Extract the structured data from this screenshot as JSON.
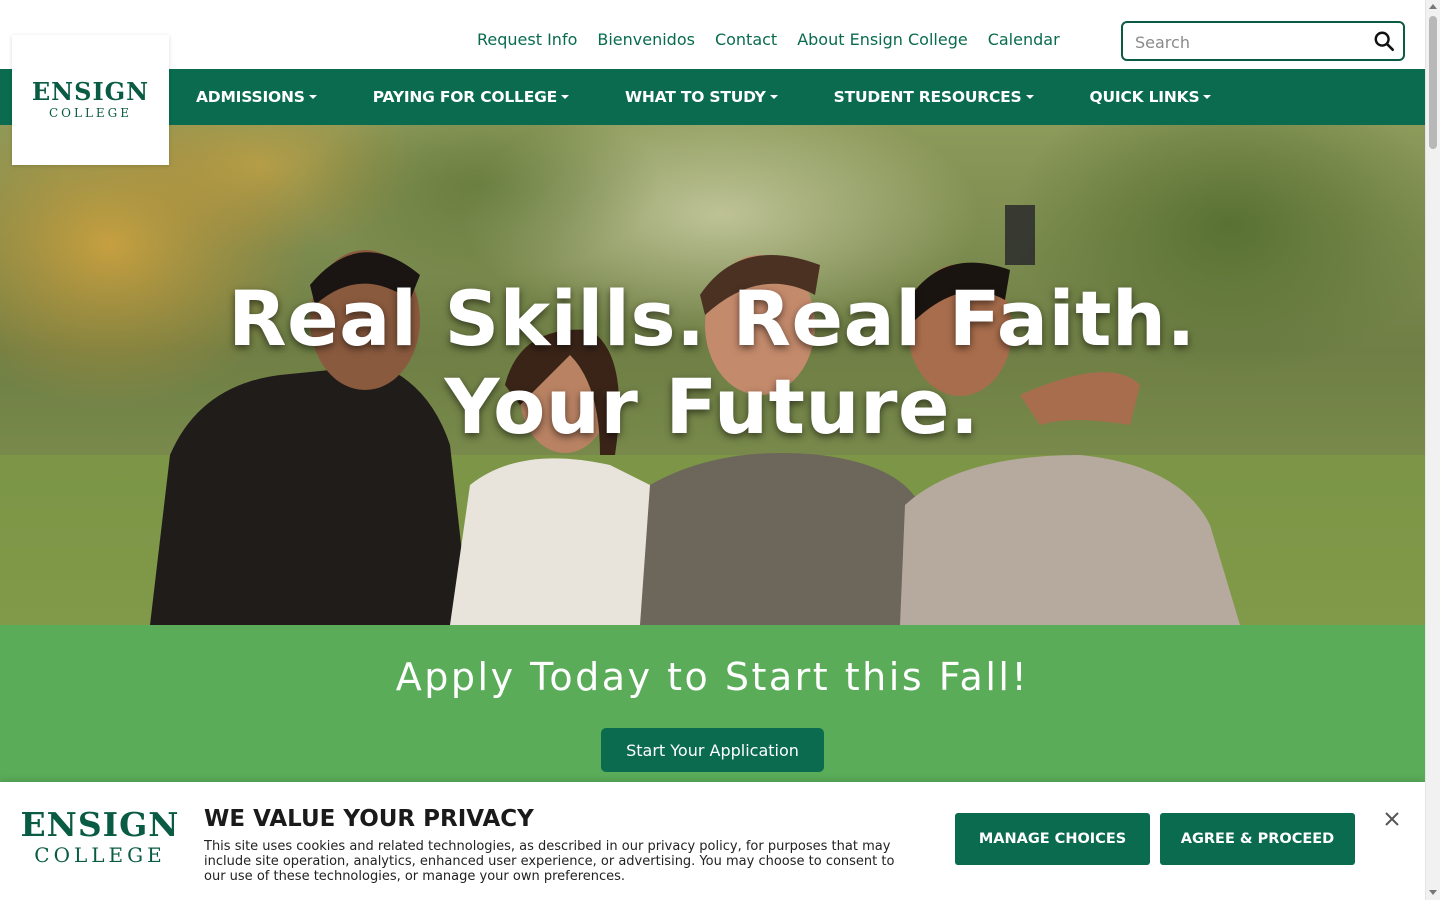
{
  "brand": {
    "logo_line1": "ENSIGN",
    "logo_line2": "COLLEGE",
    "primary_color": "#0a6b4f",
    "accent_green": "#5aac59"
  },
  "utility_nav": {
    "links": [
      "Request Info",
      "Bienvenidos",
      "Contact",
      "About Ensign College",
      "Calendar"
    ],
    "search_placeholder": "Search",
    "search_icon": "search-icon"
  },
  "main_nav": {
    "items": [
      "ADMISSIONS",
      "PAYING FOR COLLEGE",
      "WHAT TO STUDY",
      "STUDENT RESOURCES",
      "QUICK LINKS"
    ]
  },
  "hero": {
    "title": "Real Skills. Real Faith. Your Future."
  },
  "apply": {
    "title": "Apply Today to Start this Fall!",
    "button_label": "Start Your Application"
  },
  "privacy": {
    "logo_line1": "ENSIGN",
    "logo_line2": "COLLEGE",
    "title": "WE VALUE YOUR PRIVACY",
    "body": "This site uses cookies and related technologies, as described in our privacy policy, for purposes that may include site operation, analytics, enhanced user experience, or advertising. You may choose to consent to our use of these technologies, or manage your own preferences.",
    "manage_label": "MANAGE CHOICES",
    "agree_label": "AGREE & PROCEED",
    "close_icon": "close-icon"
  }
}
